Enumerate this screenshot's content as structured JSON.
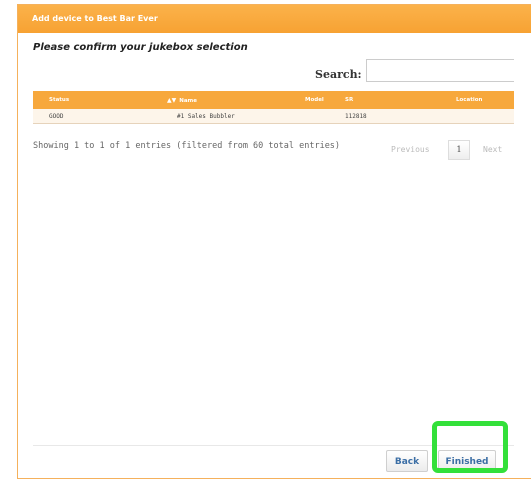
{
  "dialog": {
    "title": "Add device to Best Bar Ever",
    "heading": "Please confirm your jukebox selection"
  },
  "search": {
    "label": "Search:",
    "value": "",
    "placeholder": ""
  },
  "table": {
    "columns": [
      "Status",
      "Name",
      "Model",
      "SR",
      "Location"
    ],
    "rows": [
      {
        "status": "GOOD",
        "name": "#1 Sales Bubbler",
        "model": "",
        "sr": "112818",
        "location": ""
      }
    ]
  },
  "info": {
    "text": "Showing 1 to 1 of 1 entries (filtered from 60 total entries)"
  },
  "pagination": {
    "previous": "Previous",
    "current": "1",
    "next": "Next"
  },
  "footer": {
    "back_label": "Back",
    "finished_label": "Finished"
  },
  "colors": {
    "accent": "#f7a83c",
    "highlight": "#33e03a",
    "link": "#3b6ea5"
  },
  "icons": {
    "sort": "sort-icon"
  }
}
